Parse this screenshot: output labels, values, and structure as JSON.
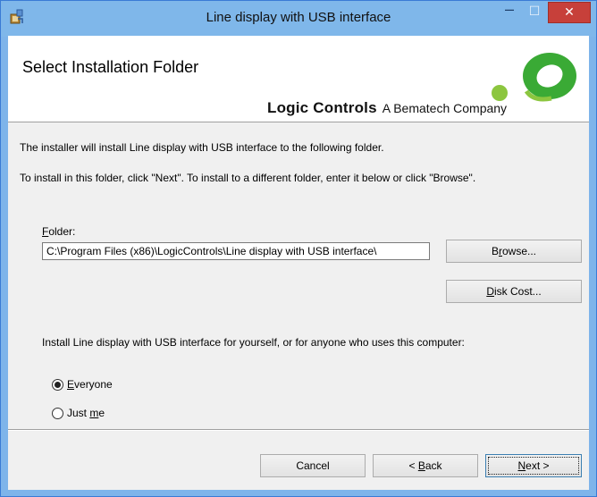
{
  "window": {
    "title": "Line display with USB interface",
    "minimize_glyph": "–",
    "maximize_glyph": "☐",
    "close_glyph": "✕"
  },
  "header": {
    "title": "Select Installation Folder",
    "brand_main": "Logic Controls",
    "brand_sub": "A Bematech Company",
    "logo_colors": [
      "#8cc63f",
      "#3aaa35"
    ]
  },
  "body": {
    "line1": "The installer will install Line display with USB interface to the following folder.",
    "line2": "To install in this folder, click \"Next\". To install to a different folder, enter it below or click \"Browse\".",
    "folder_label_accel": "F",
    "folder_label_rest": "older:",
    "folder_value": "C:\\Program Files (x86)\\LogicControls\\Line display with USB interface\\",
    "browse_accel": "r",
    "browse_pre": "B",
    "browse_post": "owse...",
    "diskcost_accel": "D",
    "diskcost_rest": "isk Cost...",
    "install_for_text": "Install Line display with USB interface for yourself, or for anyone who uses this computer:",
    "radio_everyone_accel": "E",
    "radio_everyone_rest": "veryone",
    "radio_justme_pre": "Just ",
    "radio_justme_accel": "m",
    "radio_justme_rest": "e",
    "selected": "everyone"
  },
  "footer": {
    "cancel_label": "Cancel",
    "back_pre": "< ",
    "back_accel": "B",
    "back_rest": "ack",
    "next_accel": "N",
    "next_rest": "ext >"
  }
}
